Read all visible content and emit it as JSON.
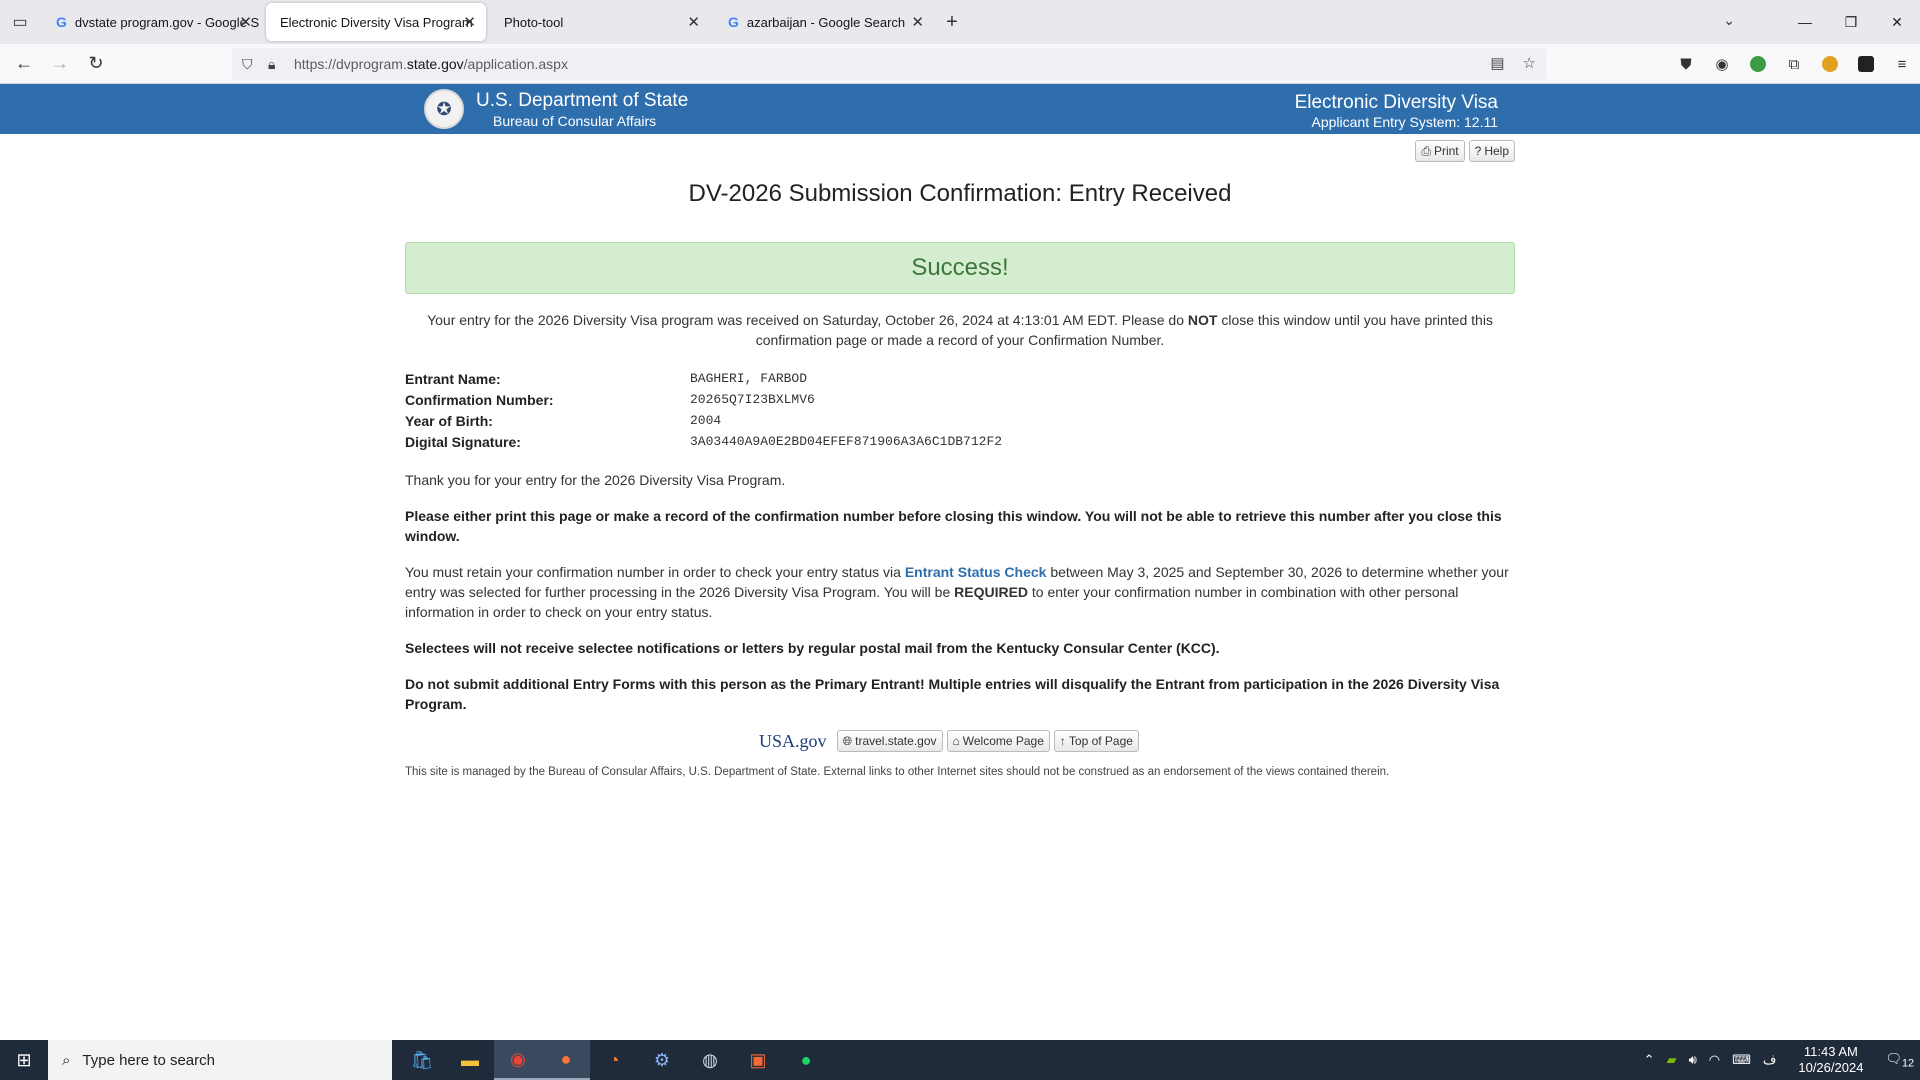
{
  "browser": {
    "tabs": [
      {
        "title": "dvstate program.gov - Google S",
        "favicon": "google-icon",
        "active": false
      },
      {
        "title": "Electronic Diversity Visa Program",
        "favicon": "",
        "active": true
      },
      {
        "title": "Photo-tool",
        "favicon": "",
        "active": false
      },
      {
        "title": "azarbaijan - Google Search",
        "favicon": "google-icon",
        "active": false
      }
    ],
    "url_prefix": "https://dvprogram.",
    "url_domain": "state.gov",
    "url_path": "/application.aspx"
  },
  "header": {
    "dept": "U.S. Department of State",
    "bureau": "Bureau of Consular Affairs",
    "system_title": "Electronic Diversity Visa",
    "system_version": "Applicant Entry System: 12.11"
  },
  "tools": {
    "print": "Print",
    "help": "Help"
  },
  "page": {
    "title": "DV-2026 Submission Confirmation: Entry Received",
    "success": "Success!",
    "notice_pre": "Your entry for the 2026 Diversity Visa program was received on Saturday, October 26, 2024 at 4:13:01 AM EDT. Please do ",
    "notice_bold": "NOT",
    "notice_post": " close this window until you have printed this confirmation page or made a record of your Confirmation Number.",
    "fields": [
      {
        "label": "Entrant Name:",
        "value": "BAGHERI, FARBOD"
      },
      {
        "label": "Confirmation Number:",
        "value": "20265Q7I23BXLMV6"
      },
      {
        "label": "Year of Birth:",
        "value": "2004"
      },
      {
        "label": "Digital Signature:",
        "value": "3A03440A9A0E2BD04EFEF871906A3A6C1DB712F2"
      }
    ],
    "thanks": "Thank you for your entry for the 2026 Diversity Visa Program.",
    "print_warning": "Please either print this page or make a record of the confirmation number before closing this window. You will not be able to retrieve this number after you close this window.",
    "retain_pre": "You must retain your confirmation number in order to check your entry status via ",
    "retain_link": "Entrant Status Check",
    "retain_mid": " between May 3, 2025 and September 30, 2026 to determine whether your entry was selected for further processing in the 2026 Diversity Visa Program. You will be ",
    "retain_bold": "REQUIRED",
    "retain_post": " to enter your confirmation number in combination with other personal information in order to check on your entry status.",
    "selectees": "Selectees will not receive selectee notifications or letters by regular postal mail from the Kentucky Consular Center (KCC).",
    "no_multiple": "Do not submit additional Entry Forms with this person as the Primary Entrant! Multiple entries will disqualify the Entrant from participation in the 2026 Diversity Visa Program."
  },
  "footer": {
    "usagov_logo": "USA.gov",
    "links": [
      "travel.state.gov",
      "Welcome Page",
      "Top of Page"
    ],
    "disclaimer": "This site is managed by the Bureau of Consular Affairs, U.S. Department of State. External links to other Internet sites should not be construed as an endorsement of the views contained therein."
  },
  "taskbar": {
    "search_placeholder": "Type here to search",
    "time": "11:43 AM",
    "date": "10/26/2024",
    "notifications": "12"
  }
}
